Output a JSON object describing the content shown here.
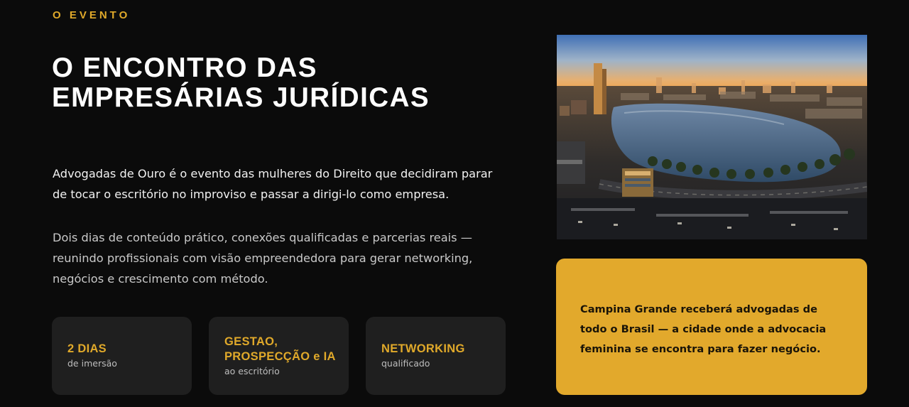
{
  "section": {
    "eyebrow": "O EVENTO",
    "title_line1": "O ENCONTRO DAS",
    "title_line2": "EMPRESÁRIAS JURÍDICAS"
  },
  "intro": {
    "lead": "Advogadas de Ouro é o evento das mulheres do Direito que decidiram parar de tocar o escritório no improviso e passar a dirigi-lo como empresa.",
    "details": "Dois dias de conteúdo prático, conexões qualificadas e parcerias reais — reunindo profissionais com visão empreendedora para gerar networking, negócios e crescimento com método."
  },
  "cards": [
    {
      "title": "2 DIAS",
      "subtitle": "de imersão"
    },
    {
      "title": "GESTAO, PROSPECÇÃO e IA",
      "subtitle": "ao escritório"
    },
    {
      "title": "NETWORKING",
      "subtitle": "qualificado"
    }
  ],
  "photo": {
    "subject": "aerial-city-lake-sunset"
  },
  "callout": {
    "text": "Campina Grande receberá advogadas de todo o Brasil — a cidade onde a advocacia feminina se encontra para fazer negócio."
  },
  "colors": {
    "background": "#0b0b0b",
    "accent_gold": "#e0a92a",
    "card_bg": "#1f1f1f",
    "callout_bg": "#e2a92c"
  }
}
